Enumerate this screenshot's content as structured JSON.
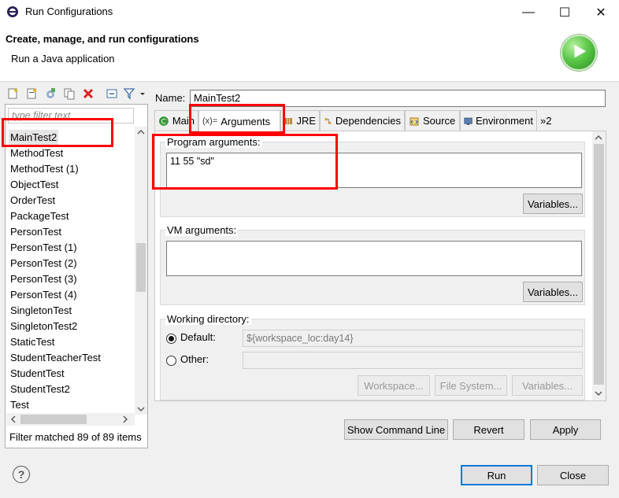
{
  "window": {
    "title": "Run Configurations",
    "minimize": "—",
    "maximize": "☐",
    "close": "✕"
  },
  "header": {
    "title": "Create, manage, and run configurations",
    "subtitle": "Run a Java application"
  },
  "left": {
    "filter_placeholder": "type filter text",
    "items": [
      "MainTest2",
      "MethodTest",
      "MethodTest (1)",
      "ObjectTest",
      "OrderTest",
      "PackageTest",
      "PersonTest",
      "PersonTest (1)",
      "PersonTest (2)",
      "PersonTest (3)",
      "PersonTest (4)",
      "SingletonTest",
      "SingletonTest2",
      "StaticTest",
      "StudentTeacherTest",
      "StudentTest",
      "StudentTest2",
      "Test"
    ],
    "selected": "MainTest2",
    "status": "Filter matched 89 of 89 items"
  },
  "config": {
    "name_label": "Name:",
    "name_value": "MainTest2",
    "tabs": [
      "Main",
      "Arguments",
      "JRE",
      "Dependencies",
      "Source",
      "Environment",
      "»2"
    ],
    "active_tab": "Arguments",
    "program_args_label": "Program arguments:",
    "program_args_value": "11 55 \"sd\"",
    "variables_label": "Variables...",
    "vm_args_label": "VM arguments:",
    "vm_args_value": "",
    "working_dir_label": "Working directory:",
    "default_label": "Default:",
    "default_value": "${workspace_loc:day14}",
    "other_label": "Other:",
    "other_value": "",
    "workspace_btn": "Workspace...",
    "filesystem_btn": "File System...",
    "variables_btn2": "Variables..."
  },
  "actions": {
    "show_cmd": "Show Command Line",
    "revert": "Revert",
    "apply": "Apply",
    "run": "Run",
    "close": "Close"
  },
  "colors": {
    "highlight": "#ff0000",
    "run_green": "#3aa52c"
  }
}
